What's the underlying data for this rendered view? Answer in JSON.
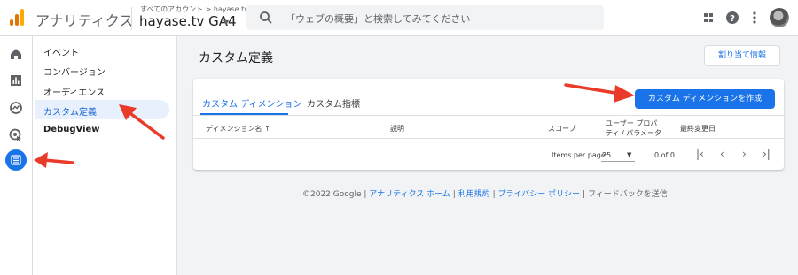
{
  "header": {
    "app_title": "アナリティクス",
    "account_breadcrumb": "すべてのアカウント > hayase.tv",
    "property_name": "hayase.tv GA4",
    "search_placeholder": "「ウェブの概要」と検索してみてください"
  },
  "subnav": {
    "items": [
      {
        "label": "イベント"
      },
      {
        "label": "コンバージョン"
      },
      {
        "label": "オーディエンス"
      },
      {
        "label": "カスタム定義"
      },
      {
        "label": "DebugView"
      }
    ],
    "selected": "カスタム定義"
  },
  "page": {
    "title": "カスタム定義",
    "quota_button": "割り当て情報"
  },
  "tabs": [
    {
      "label": "カスタム ディメンション",
      "active": true
    },
    {
      "label": "カスタム指標",
      "active": false
    }
  ],
  "create_button": "カスタム ディメンションを作成",
  "table": {
    "columns": [
      "ディメンション名 ↑",
      "説明",
      "スコープ",
      "ユーザー プロパティ / パラメータ",
      "最終変更日"
    ],
    "col_user_prop_line1": "ユーザー プロパ",
    "col_user_prop_line2": "ティ / パラメータ"
  },
  "pagination": {
    "items_per_page_label": "Items per page:",
    "items_per_page_value": "25",
    "range": "0 of 0"
  },
  "footer": {
    "copyright": "©2022 Google",
    "links": [
      "アナリティクス ホーム",
      "利用規約",
      "プライバシー ポリシー"
    ],
    "feedback": "フィードバックを送信"
  },
  "colors": {
    "accent": "#1a73e8",
    "annotation_arrow": "#ea3a2a"
  }
}
